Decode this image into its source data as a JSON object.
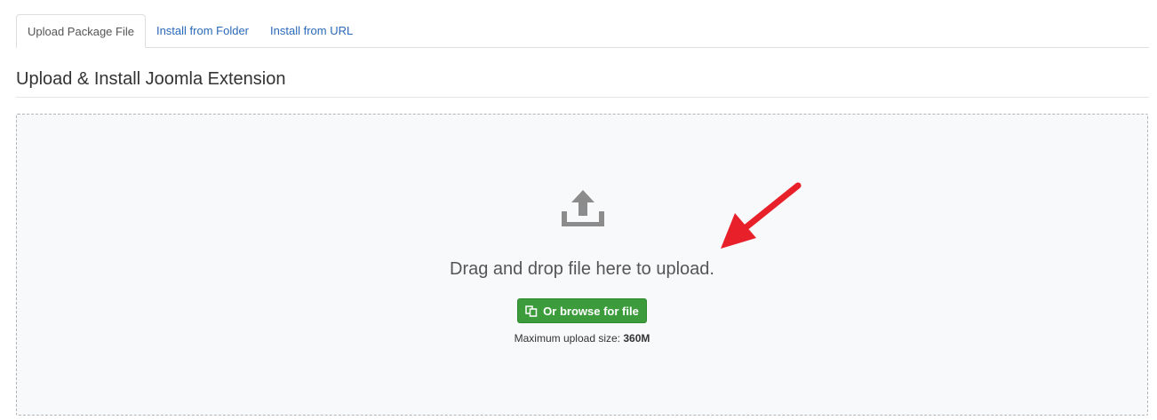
{
  "tabs": [
    {
      "label": "Upload Package File",
      "active": true
    },
    {
      "label": "Install from Folder",
      "active": false
    },
    {
      "label": "Install from URL",
      "active": false
    }
  ],
  "page_title": "Upload & Install Joomla Extension",
  "dropzone": {
    "icon": "upload-icon",
    "drop_text": "Drag and drop file here to upload.",
    "browse_button_label": "Or browse for file",
    "browse_icon": "copy-files-icon",
    "max_size_label": "Maximum upload size: ",
    "max_size_value": "360M"
  },
  "annotation": {
    "icon": "red-arrow-annotation",
    "color": "#e8202a"
  },
  "colors": {
    "link": "#2a69b8",
    "button_green": "#3c9c3c",
    "dropzone_bg": "#f8f9fb"
  }
}
